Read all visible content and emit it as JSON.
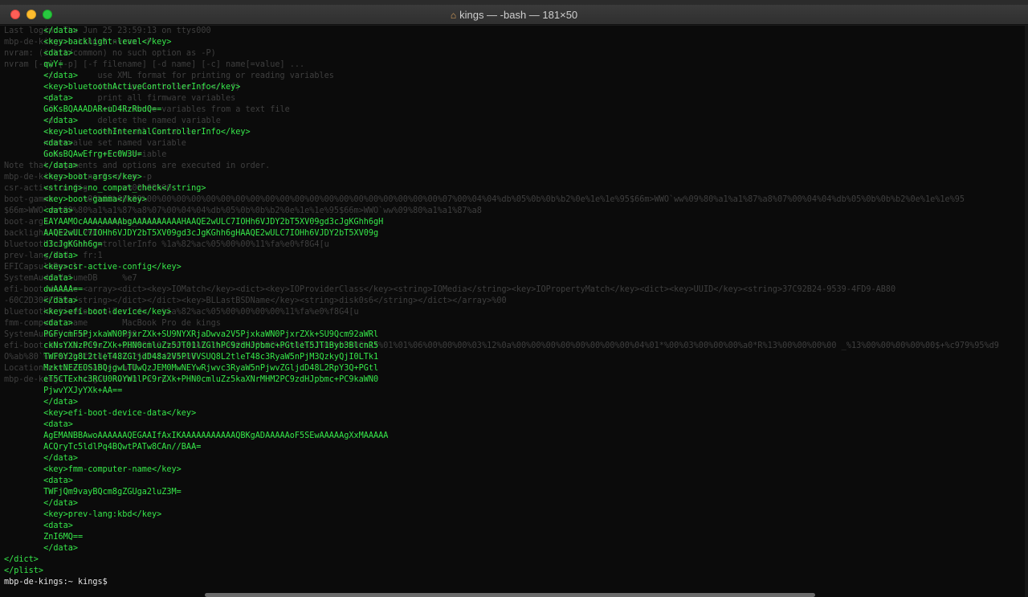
{
  "window": {
    "title_icon": "house-icon",
    "title": "kings — -bash — 181×50"
  },
  "background_lines": [
    "Last login: Thu Jun 25 23:59:13 on ttys000",
    "mbp-de-kings:~ kings$ nvram -P",
    "nvram: (iokit/common) no such option as -P)",
    "nvram [-x] [-p] [-f filename] [-d name] [-c] name[=value] ...",
    "        -x         use XML format for printing or reading variables",
    "                   (must appear before -p or -f)",
    "        -p         print all firmware variables",
    "        -f         set firmware variables from a text file",
    "        -d         delete the named variable",
    "        -c         delete all variables",
    "        name=value set named variable",
    "        name       print variable",
    "Note that arguments and options are executed in order.",
    "mbp-de-kings:~ kings$ nvram -p",
    "csr-active-config       w%00%00%00",
    "boot-gamma      %00%00%00%00%00%00%00%00%00%00%00%00%00%00%00%00%00%00%00%00%00%00%00%00%07%00%04%04%db%05%0b%0b%b2%0e%1e%1e%95$66m>WWO`ww%09%80%a1%a1%87%a8%07%00%04%04%db%05%0b%0b%b2%0e%1e%1e%95",
    "$66m>WWO`ww%09%80%a1%a1%87%a8%07%00%04%04%db%05%0b%0b%b2%0e%1e%1e%95$66m>WWO`ww%09%80%a1%a1%87%a8",
    "boot-args       -no_compat_check",
    "backlight-level 7%00",
    "bluetoothInternalControllerInfo %1a%82%ac%05%00%00%11%fa%e0%f8G4[u",
    "prev-lang:kbd   fr:1",
    "EFICapsuleResult        ",
    "SystemAudioVolumeDB     %e7",
    "efi-boot-device <array><dict><key>IOMatch</key><dict><key>IOProviderClass</key><string>IOMedia</string><key>IOPropertyMatch</key><dict><key>UUID</key><string>37C92B24-9539-4FD9-AB80",
    "-60C2D30FCD5B</string></dict></dict><key>BLLastBSDName</key><string>disk0s6</string></dict></array>%00",
    "bluetoothActiveControllerInfo   %1a%82%ac%05%00%00%00%00%11%fa%e0%f8G4[u",
    "fmm-computer-name       MacBook Pro de kings",
    "SystemAudioVolume       %00",
    "efi-boot-device-data    %02%01%0c%00%d0A%03%0a%00%00%00%00%01%01%06%00%00%1f%01%01%06%00%00%00%03%12%0a%00%00%00%00%00%00%00%00%04%01*%00%03%00%00%00%a0*R%13%00%00%00%00 _%13%00%00%00%00%00$+%c979%95%d9",
    "O%ab%80`%c2%d3%0f%cd[%02%02%7f%ff%04%00",
    "LocationServicesEnabled %01",
    "mbp-de-kings:~ kings$ nvram -x -p"
  ],
  "terminal_lines": [
    "        </data>",
    "        <key>backlight-level</key>",
    "        <data>",
    "        qwY=",
    "        </data>",
    "        <key>bluetoothActiveControllerInfo</key>",
    "        <data>",
    "        GoKsBQAAADAR+uD4RzRbdQ==",
    "        </data>",
    "        <key>bluetoothInternalControllerInfo</key>",
    "        <data>",
    "        GoKsBQAwEfrg+Ec0W3U=",
    "        </data>",
    "        <key>boot-args</key>",
    "        <string>-no_compat_check</string>",
    "        <key>boot-gamma</key>",
    "        <data>",
    "        EAYAAMOcAAAAAAAAbgAAAAAAAAAAHAAQE2wULC7IOHh6VJDY2bT5XV09gd3cJgKGhh6gH",
    "        AAQE2wULC7IOHh6VJDY2bT5XV09gd3cJgKGhh6gHAAQE2wULC7IOHh6VJDY2bT5XV09g",
    "        d3cJgKGhh6g=",
    "        </data>",
    "        <key>csr-active-config</key>",
    "        <data>",
    "        dwAAAA==",
    "        </data>",
    "        <key>efi-boot-device</key>",
    "        <data>",
    "        PGFycmF5PjxkaWN0PjxrZXk+SU9NYXRjaDwva2V5PjxkaWN0PjxrZXk+SU9Qcm92aWRl",
    "        ckNsYXNzPC9rZXk+PHN0cmluZz5JT01lZGlhPC9zdHJpbmc+PGtleT5JT1Byb3BlcnR5",
    "        TWF0Y2g8L2tleT48ZGljdD48a2V5PlVVSUQ8L2tleT48c3RyaW5nPjM3QzkyQjI0LTk1",
    "        MzktNEZEOS1BQjgwLTUwQzJEM0MwNEYwRjwvc3RyaW5nPjwvZGljdD48L2RpY3Q+PGtl",
    "        eT5CTExhc3RCU0ROYW1lPC9rZXk+PHN0cmluZz5kaXNrMHM2PC9zdHJpbmc+PC9kaWN0",
    "        PjwvYXJyYXk+AA==",
    "        </data>",
    "        <key>efi-boot-device-data</key>",
    "        <data>",
    "        AgEMANBBAwoAAAAAAQEGAAIfAxIKAAAAAAAAAAAQBKgADAAAAAoF5SEwAAAAAgXxMAAAAA",
    "        ACQryTc5ldlPq4BQwtPATw8CAn//BAA=",
    "        </data>",
    "        <key>fmm-computer-name</key>",
    "        <data>",
    "        TWFjQm9vayBQcm8gZGUga2luZ3M=",
    "        </data>",
    "        <key>prev-lang:kbd</key>",
    "        <data>",
    "        ZnI6MQ==",
    "        </data>",
    "</dict>",
    "</plist>",
    "mbp-de-kings:~ kings$ "
  ]
}
